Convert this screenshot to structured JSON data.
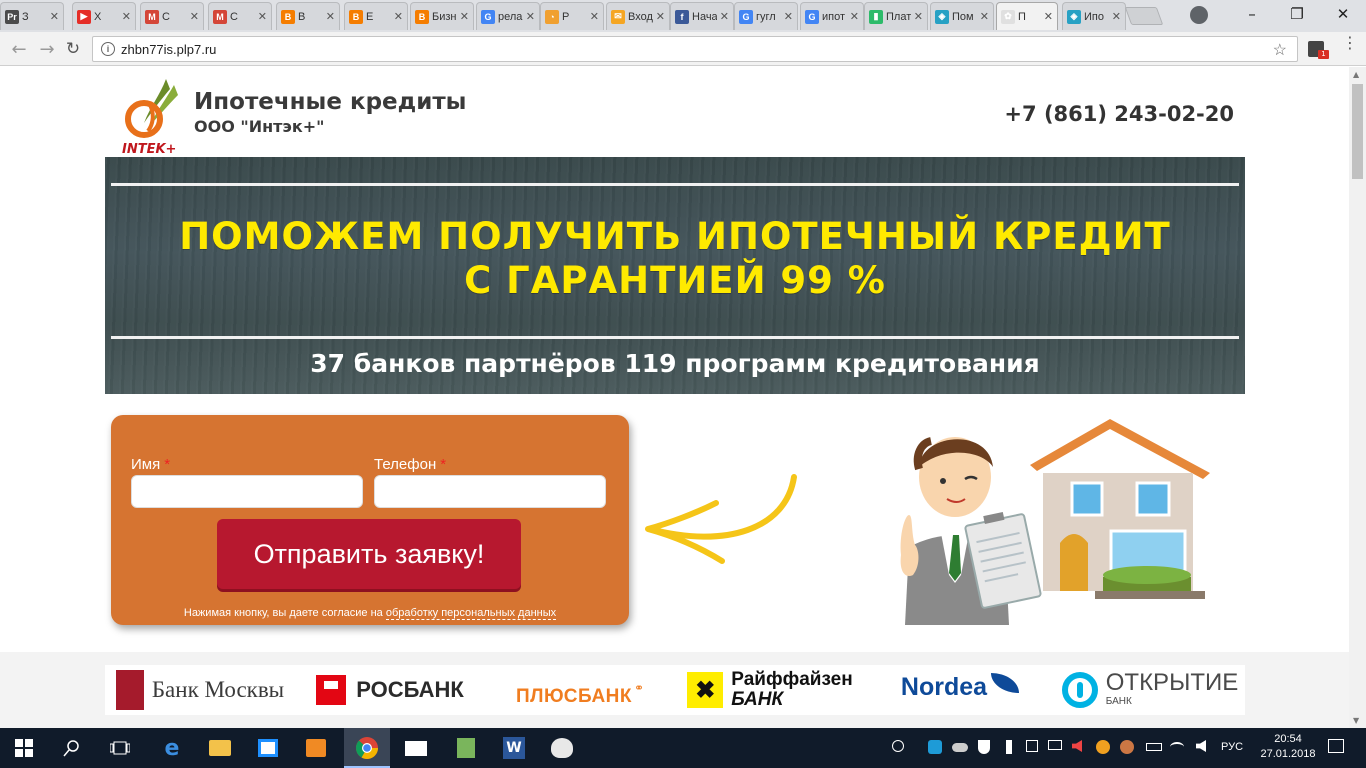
{
  "browser": {
    "tabs": [
      {
        "label": "З",
        "color": "#4b4b4b",
        "glyph": "Pr"
      },
      {
        "label": "Х",
        "color": "#e52d27",
        "glyph": "▶"
      },
      {
        "label": "С",
        "color": "#d44638",
        "glyph": "M"
      },
      {
        "label": "С",
        "color": "#d44638",
        "glyph": "M"
      },
      {
        "label": "В",
        "color": "#f57d00",
        "glyph": "B"
      },
      {
        "label": "Е",
        "color": "#f57d00",
        "glyph": "B"
      },
      {
        "label": "Бизн",
        "color": "#f57d00",
        "glyph": "B"
      },
      {
        "label": "рела",
        "color": "#4285f4",
        "glyph": "G"
      },
      {
        "label": "Р",
        "color": "#f0a030",
        "glyph": "◔"
      },
      {
        "label": "Вход",
        "color": "#f5a623",
        "glyph": "✉"
      },
      {
        "label": "Нача",
        "color": "#3b5998",
        "glyph": "f"
      },
      {
        "label": "гугл",
        "color": "#4285f4",
        "glyph": "G"
      },
      {
        "label": "ипот",
        "color": "#4285f4",
        "glyph": "G"
      },
      {
        "label": "Плат",
        "color": "#2dbb6a",
        "glyph": "▮"
      },
      {
        "label": "Пом",
        "color": "#27a1c4",
        "glyph": "◈"
      },
      {
        "label": "П",
        "color": "#e0e0e0",
        "glyph": "✿"
      },
      {
        "label": "Ипо",
        "color": "#27a1c4",
        "glyph": "◈"
      }
    ],
    "url": "zhbn77is.plp7.ru",
    "ext_badge": "1"
  },
  "header": {
    "logo_text": "INTEK+",
    "title": "Ипотечные кредиты",
    "company": "ООО \"Интэк+\"",
    "phone": "+7 (861) 243-02-20"
  },
  "banner": {
    "headline_line1": "ПОМОЖЕМ ПОЛУЧИТЬ ИПОТЕЧНЫЙ КРЕДИТ",
    "headline_line2": "С ГАРАНТИЕЙ 99 %",
    "subline": "37 банков партнёров 119 программ кредитования"
  },
  "form": {
    "name_label": "Имя",
    "phone_label": "Телефон",
    "required_mark": "*",
    "name_value": "",
    "phone_value": "",
    "submit_label": "Отправить заявку!",
    "consent_text": "Нажимая кнопку, вы даете согласие на",
    "consent_link": "обработку персональных данных"
  },
  "banks": [
    {
      "name": "Банк Москвы"
    },
    {
      "name": "РОСБАНК"
    },
    {
      "name": "ПЛЮСБАНК"
    },
    {
      "name": "Райффайзен",
      "line2": "БАНК"
    },
    {
      "name": "Nordea"
    },
    {
      "name": "ОТКРЫТИЕ",
      "line2": "БАНК"
    }
  ],
  "taskbar": {
    "language": "РУС",
    "time": "20:54",
    "date": "27.01.2018"
  },
  "colors": {
    "accent_yellow": "#ffea00",
    "form_orange": "#d67431",
    "button_red": "#b7182f"
  }
}
